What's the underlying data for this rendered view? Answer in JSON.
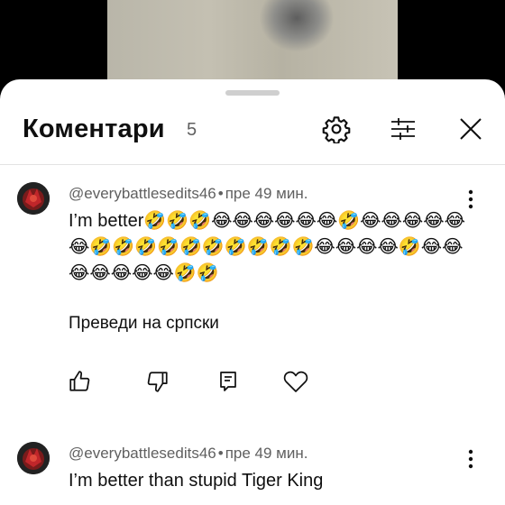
{
  "header": {
    "title": "Коментари",
    "count": "5"
  },
  "comments": [
    {
      "author": "@everybattlesedits46",
      "time": "пре 49 мин.",
      "text": "I’m better🤣🤣🤣😂😂😂😂😂😂🤣😂😂😂😂😂😂🤣🤣🤣🤣🤣🤣🤣🤣🤣🤣😂😂😂😂🤣😂😂😂😂😂😂😂🤣🤣",
      "translate_label": "Преведи на српски"
    },
    {
      "author": "@everybattlesedits46",
      "time": "пре 49 мин.",
      "text": "I’m better than stupid Tiger King"
    }
  ],
  "icons": {
    "settings": "gear-icon",
    "filter": "sort-filter-icon",
    "close": "close-icon",
    "like": "thumbs-up-icon",
    "dislike": "thumbs-down-icon",
    "reply": "reply-icon",
    "heart": "heart-icon",
    "more": "more-vert-icon"
  },
  "colors": {
    "text_primary": "#0f0f0f",
    "text_secondary": "#606060",
    "sheet_bg": "#ffffff"
  }
}
